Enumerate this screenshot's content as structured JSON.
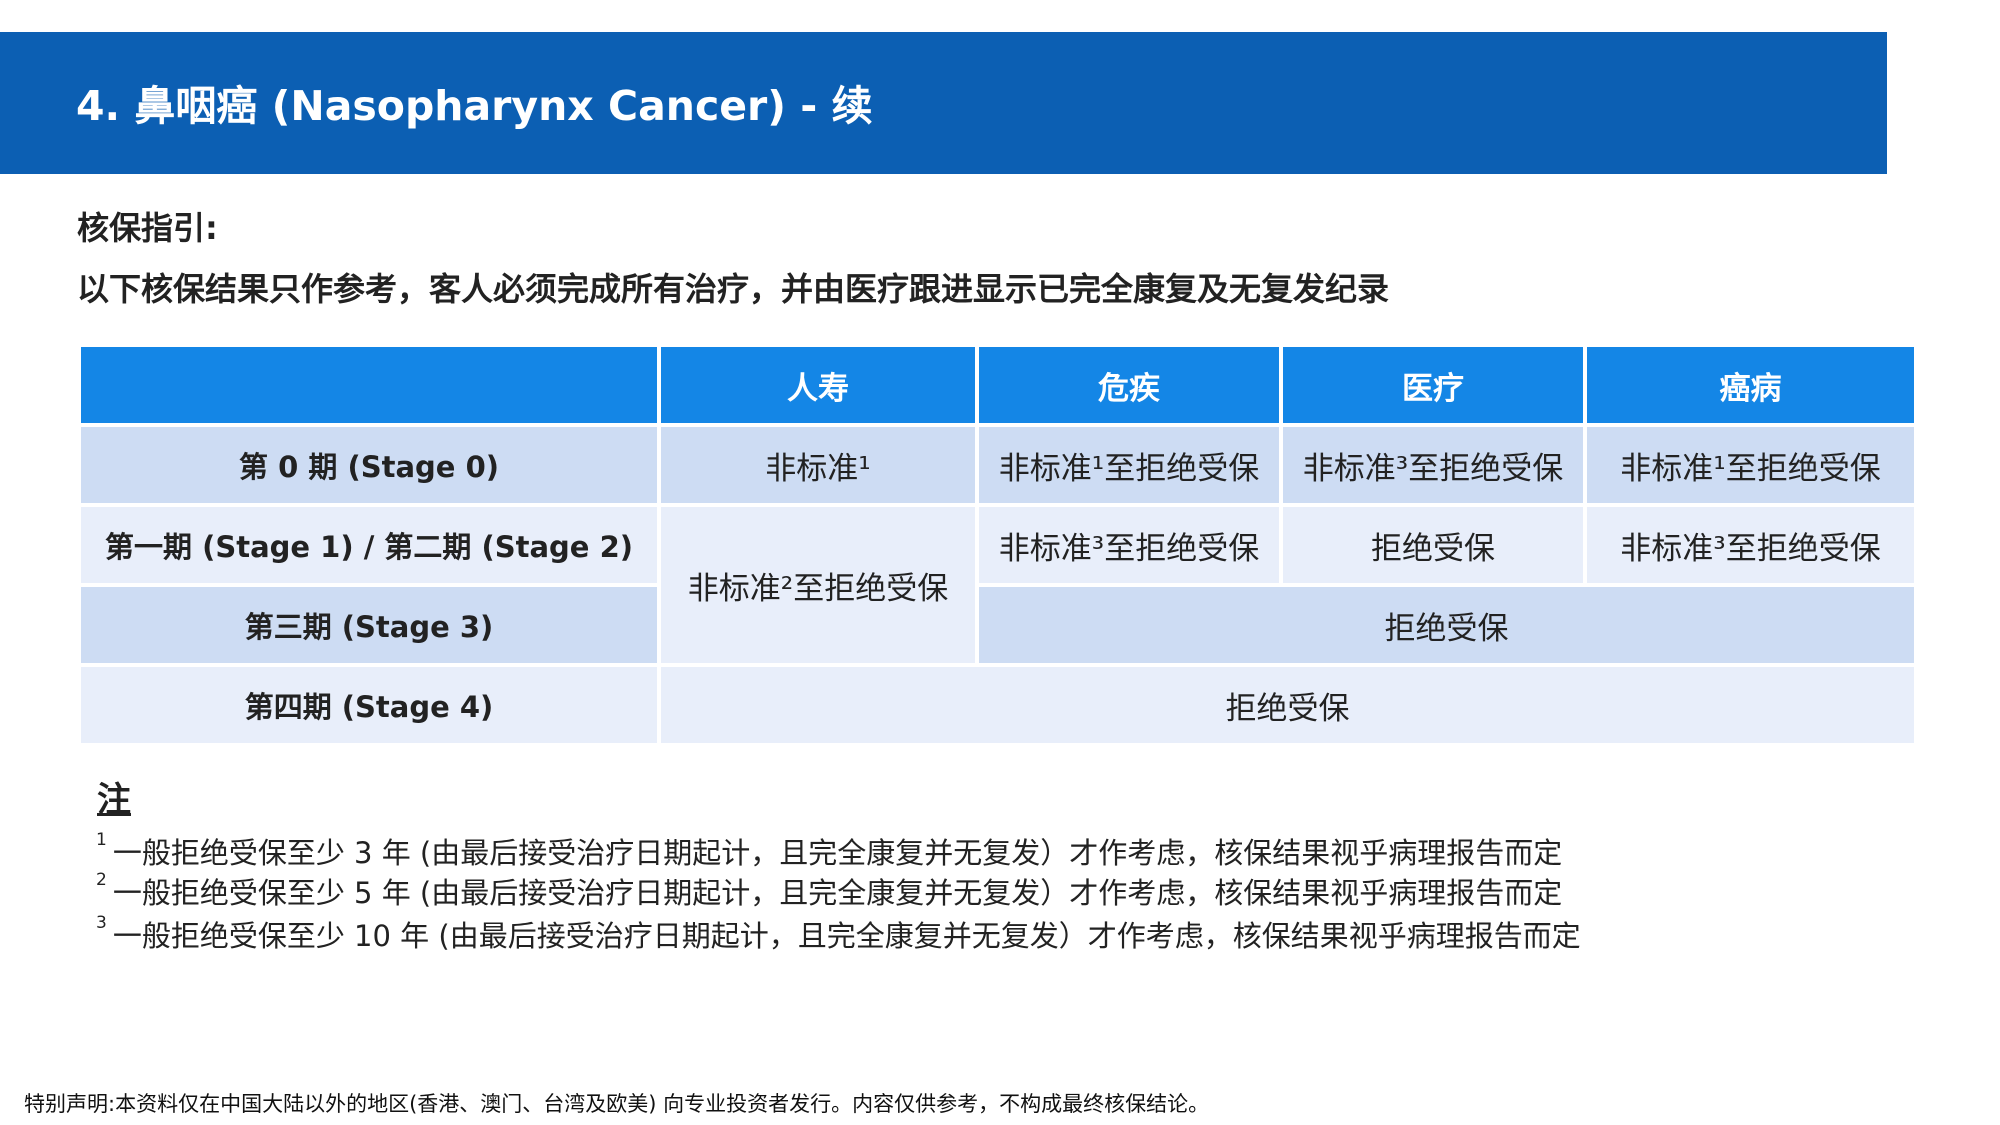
{
  "title": "4. 鼻咽癌 (Nasopharynx Cancer)  - 续",
  "guide": {
    "heading": "核保指引:",
    "text": "以下核保结果只作参考，客人必须完成所有治疗，并由医疗跟进显示已完全康复及无复发纪录"
  },
  "table": {
    "headers": [
      "",
      "人寿",
      "危疾",
      "医疗",
      "癌病"
    ],
    "rows": [
      {
        "stage": "第 0 期 (Stage 0)",
        "life": "非标准¹",
        "ci": "非标准¹至拒绝受保",
        "medical": "非标准³至拒绝受保",
        "cancer": "非标准¹至拒绝受保"
      },
      {
        "stage": "第一期 (Stage 1) / 第二期 (Stage 2)",
        "ci": "非标准³至拒绝受保",
        "medical": "拒绝受保",
        "cancer": "非标准³至拒绝受保"
      },
      {
        "stage": "第三期 (Stage 3)",
        "merged": "拒绝受保"
      },
      {
        "stage": "第四期 (Stage 4)",
        "merged": "拒绝受保"
      }
    ],
    "life_stage1to3": "非标准²至拒绝受保"
  },
  "notes": {
    "title": "注",
    "items": [
      {
        "marker": "1",
        "text": "一般拒绝受保至少 3 年 (由最后接受治疗日期起计，且完全康复并无复发）才作考虑，核保结果视乎病理报告而定"
      },
      {
        "marker": "2",
        "text": "一般拒绝受保至少 5 年 (由最后接受治疗日期起计，且完全康复并无复发）才作考虑，核保结果视乎病理报告而定"
      },
      {
        "marker": "3",
        "text": "一般拒绝受保至少 10 年 (由最后接受治疗日期起计，且完全康复并无复发）才作考虑，核保结果视乎病理报告而定"
      }
    ]
  },
  "disclaimer": "特别声明:本资料仅在中国大陆以外的地区(香港、澳门、台湾及欧美) 向专业投资者发行。内容仅供参考，不构成最终核保结论。",
  "colors": {
    "title_bar": "#0c5fb3",
    "table_header": "#1486e6",
    "row_dark": "#cddcf3",
    "row_light": "#e8eefa"
  }
}
